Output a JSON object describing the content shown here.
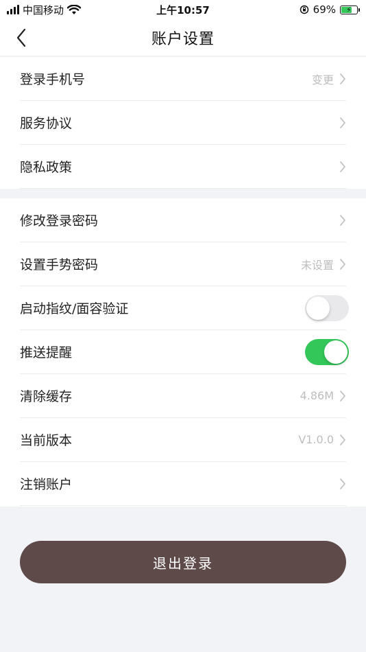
{
  "status_bar": {
    "carrier": "中国移动",
    "time": "上午10:57",
    "battery_percent": "69%",
    "battery_level": 0.69
  },
  "nav": {
    "title": "账户设置",
    "back_icon": "chevron-left-icon"
  },
  "group1": [
    {
      "label": "登录手机号",
      "value": "变更"
    },
    {
      "label": "服务协议",
      "value": ""
    },
    {
      "label": "隐私政策",
      "value": ""
    }
  ],
  "group2": [
    {
      "label": "修改登录密码",
      "value": ""
    },
    {
      "label": "设置手势密码",
      "value": "未设置"
    },
    {
      "label": "启动指纹/面容验证",
      "toggle": false
    },
    {
      "label": "推送提醒",
      "toggle": true
    },
    {
      "label": "清除缓存",
      "value": "4.86M"
    },
    {
      "label": "当前版本",
      "value": "V1.0.0"
    },
    {
      "label": "注销账户",
      "value": ""
    }
  ],
  "logout": {
    "label": "退出登录"
  },
  "colors": {
    "accent_toggle_on": "#33c659",
    "logout_button": "#5e4a48",
    "secondary_text": "#bdbdbd"
  }
}
